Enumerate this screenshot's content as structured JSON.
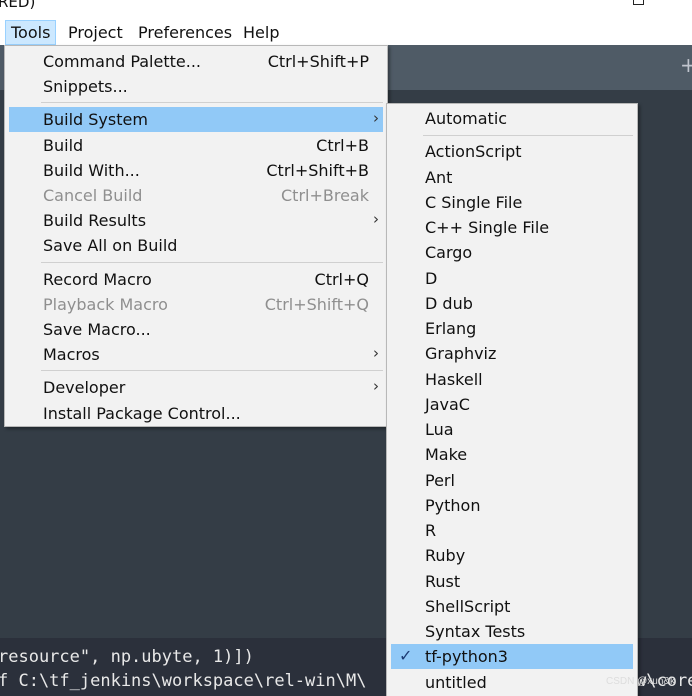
{
  "window": {
    "title_fragment": "RED)"
  },
  "menubar": {
    "items": [
      {
        "label": "Tools",
        "active": true
      },
      {
        "label": "Project"
      },
      {
        "label": "Preferences"
      },
      {
        "label": "Help"
      }
    ]
  },
  "tools_menu": {
    "groups": [
      [
        {
          "label": "Command Palette...",
          "shortcut": "Ctrl+Shift+P"
        },
        {
          "label": "Snippets..."
        }
      ],
      [
        {
          "label": "Build System",
          "submenu": true,
          "highlight": true
        },
        {
          "label": "Build",
          "shortcut": "Ctrl+B"
        },
        {
          "label": "Build With...",
          "shortcut": "Ctrl+Shift+B"
        },
        {
          "label": "Cancel Build",
          "shortcut": "Ctrl+Break",
          "disabled": true
        },
        {
          "label": "Build Results",
          "submenu": true
        },
        {
          "label": "Save All on Build"
        }
      ],
      [
        {
          "label": "Record Macro",
          "shortcut": "Ctrl+Q"
        },
        {
          "label": "Playback Macro",
          "shortcut": "Ctrl+Shift+Q",
          "disabled": true
        },
        {
          "label": "Save Macro..."
        },
        {
          "label": "Macros",
          "submenu": true
        }
      ],
      [
        {
          "label": "Developer",
          "submenu": true
        },
        {
          "label": "Install Package Control..."
        }
      ]
    ]
  },
  "build_system_menu": {
    "items": [
      {
        "label": "Automatic"
      },
      {
        "label": "ActionScript"
      },
      {
        "label": "Ant"
      },
      {
        "label": "C Single File"
      },
      {
        "label": "C++ Single File"
      },
      {
        "label": "Cargo"
      },
      {
        "label": "D"
      },
      {
        "label": "D dub"
      },
      {
        "label": "Erlang"
      },
      {
        "label": "Graphviz"
      },
      {
        "label": "Haskell"
      },
      {
        "label": "JavaC"
      },
      {
        "label": "Lua"
      },
      {
        "label": "Make"
      },
      {
        "label": "Perl"
      },
      {
        "label": "Python"
      },
      {
        "label": "R"
      },
      {
        "label": "Ruby"
      },
      {
        "label": "Rust"
      },
      {
        "label": "ShellScript"
      },
      {
        "label": "Syntax Tests"
      },
      {
        "label": "tf-python3",
        "checked": true,
        "highlight": true
      },
      {
        "label": "untitled"
      }
    ]
  },
  "console": {
    "lines": [
      "resource\", np.ubyte, 1)])",
      "f C:\\tf_jenkins\\workspace\\rel-win\\M\\",
      "w\\core"
    ]
  },
  "icons": {
    "submenu_arrow": "chevron-right-icon",
    "check": "check-icon",
    "new_tab": "plus-icon"
  },
  "colors": {
    "highlight": "#91c9f7",
    "menu_bg": "#f2f2f2",
    "editor_bg": "#343d46",
    "tabstrip_bg": "#4f5b66"
  },
  "watermark": "CSDN @xun&k"
}
